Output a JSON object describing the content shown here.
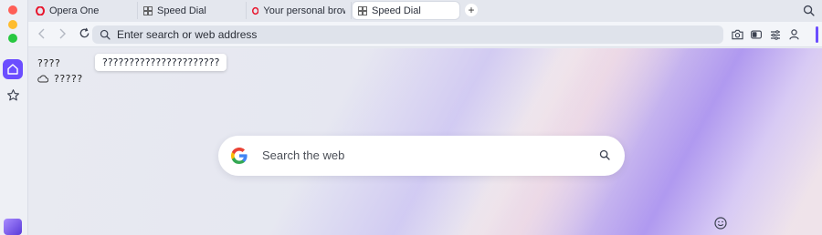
{
  "tabs": [
    {
      "label": "Opera One",
      "icon": "opera-icon"
    },
    {
      "label": "Speed Dial",
      "icon": "speed-dial-icon"
    },
    {
      "label": "Your personal browser in",
      "icon": "opera-icon"
    },
    {
      "label": "Speed Dial",
      "icon": "speed-dial-icon",
      "active": true
    }
  ],
  "new_tab_label": "+",
  "address": {
    "placeholder": "Enter search or web address"
  },
  "content": {
    "glyphs_line1": "????",
    "tooltip_glyphs": "??????????????????????",
    "glyphs_line2": "?????",
    "search_placeholder": "Search the web"
  },
  "colors": {
    "accent": "#6b4dff",
    "opera_red": "#e8142b"
  }
}
